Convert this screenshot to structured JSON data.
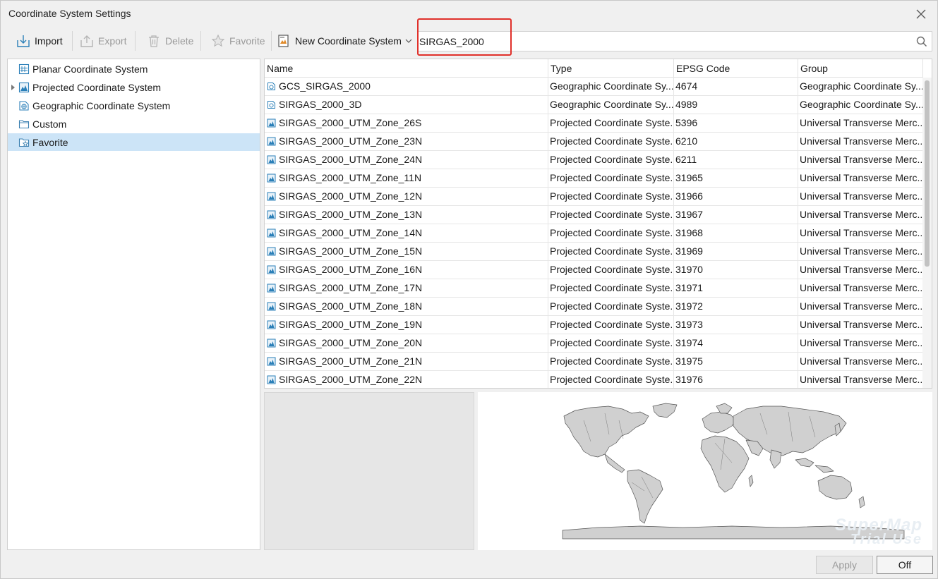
{
  "window": {
    "title": "Coordinate System Settings"
  },
  "toolbar": {
    "import_label": "Import",
    "export_label": "Export",
    "delete_label": "Delete",
    "favorite_label": "Favorite",
    "new_cs_label": "New Coordinate System"
  },
  "search": {
    "value": "SIRGAS_2000",
    "placeholder": ""
  },
  "tree": {
    "items": [
      {
        "label": "Planar Coordinate System",
        "icon": "planar-cs-icon",
        "expandable": false
      },
      {
        "label": "Projected Coordinate System",
        "icon": "projected-cs-icon",
        "expandable": true
      },
      {
        "label": "Geographic Coordinate System",
        "icon": "geographic-cs-icon",
        "expandable": false
      },
      {
        "label": "Custom",
        "icon": "folder-icon",
        "expandable": false
      },
      {
        "label": "Favorite",
        "icon": "favorite-folder-icon",
        "expandable": false,
        "selected": true
      }
    ]
  },
  "table": {
    "columns": [
      "Name",
      "Type",
      "EPSG Code",
      "Group"
    ],
    "rows": [
      {
        "name": "GCS_SIRGAS_2000",
        "type": "Geographic Coordinate Sy...",
        "epsg": "4674",
        "group": "Geographic Coordinate Sy...",
        "icon": "geographic-cs-icon"
      },
      {
        "name": "SIRGAS_2000_3D",
        "type": "Geographic Coordinate Sy...",
        "epsg": "4989",
        "group": "Geographic Coordinate Sy...",
        "icon": "geographic-cs-icon"
      },
      {
        "name": "SIRGAS_2000_UTM_Zone_26S",
        "type": "Projected Coordinate Syste...",
        "epsg": "5396",
        "group": "Universal Transverse Merc...",
        "icon": "projected-cs-icon"
      },
      {
        "name": "SIRGAS_2000_UTM_Zone_23N",
        "type": "Projected Coordinate Syste...",
        "epsg": "6210",
        "group": "Universal Transverse Merc...",
        "icon": "projected-cs-icon"
      },
      {
        "name": "SIRGAS_2000_UTM_Zone_24N",
        "type": "Projected Coordinate Syste...",
        "epsg": "6211",
        "group": "Universal Transverse Merc...",
        "icon": "projected-cs-icon"
      },
      {
        "name": "SIRGAS_2000_UTM_Zone_11N",
        "type": "Projected Coordinate Syste...",
        "epsg": "31965",
        "group": "Universal Transverse Merc...",
        "icon": "projected-cs-icon"
      },
      {
        "name": "SIRGAS_2000_UTM_Zone_12N",
        "type": "Projected Coordinate Syste...",
        "epsg": "31966",
        "group": "Universal Transverse Merc...",
        "icon": "projected-cs-icon"
      },
      {
        "name": "SIRGAS_2000_UTM_Zone_13N",
        "type": "Projected Coordinate Syste...",
        "epsg": "31967",
        "group": "Universal Transverse Merc...",
        "icon": "projected-cs-icon"
      },
      {
        "name": "SIRGAS_2000_UTM_Zone_14N",
        "type": "Projected Coordinate Syste...",
        "epsg": "31968",
        "group": "Universal Transverse Merc...",
        "icon": "projected-cs-icon"
      },
      {
        "name": "SIRGAS_2000_UTM_Zone_15N",
        "type": "Projected Coordinate Syste...",
        "epsg": "31969",
        "group": "Universal Transverse Merc...",
        "icon": "projected-cs-icon"
      },
      {
        "name": "SIRGAS_2000_UTM_Zone_16N",
        "type": "Projected Coordinate Syste...",
        "epsg": "31970",
        "group": "Universal Transverse Merc...",
        "icon": "projected-cs-icon"
      },
      {
        "name": "SIRGAS_2000_UTM_Zone_17N",
        "type": "Projected Coordinate Syste...",
        "epsg": "31971",
        "group": "Universal Transverse Merc...",
        "icon": "projected-cs-icon"
      },
      {
        "name": "SIRGAS_2000_UTM_Zone_18N",
        "type": "Projected Coordinate Syste...",
        "epsg": "31972",
        "group": "Universal Transverse Merc...",
        "icon": "projected-cs-icon"
      },
      {
        "name": "SIRGAS_2000_UTM_Zone_19N",
        "type": "Projected Coordinate Syste...",
        "epsg": "31973",
        "group": "Universal Transverse Merc...",
        "icon": "projected-cs-icon"
      },
      {
        "name": "SIRGAS_2000_UTM_Zone_20N",
        "type": "Projected Coordinate Syste...",
        "epsg": "31974",
        "group": "Universal Transverse Merc...",
        "icon": "projected-cs-icon"
      },
      {
        "name": "SIRGAS_2000_UTM_Zone_21N",
        "type": "Projected Coordinate Syste...",
        "epsg": "31975",
        "group": "Universal Transverse Merc...",
        "icon": "projected-cs-icon"
      },
      {
        "name": "SIRGAS_2000_UTM_Zone_22N",
        "type": "Projected Coordinate Syste...",
        "epsg": "31976",
        "group": "Universal Transverse Merc...",
        "icon": "projected-cs-icon"
      }
    ]
  },
  "preview": {
    "watermark_line1": "SuperMap",
    "watermark_line2": "Trial Use"
  },
  "footer": {
    "apply_label": "Apply",
    "off_label": "Off"
  },
  "colors": {
    "selection": "#cce4f7",
    "highlight_border": "#e0302a",
    "icon_blue": "#2a7fb8",
    "land_fill": "#d0d0d0"
  }
}
